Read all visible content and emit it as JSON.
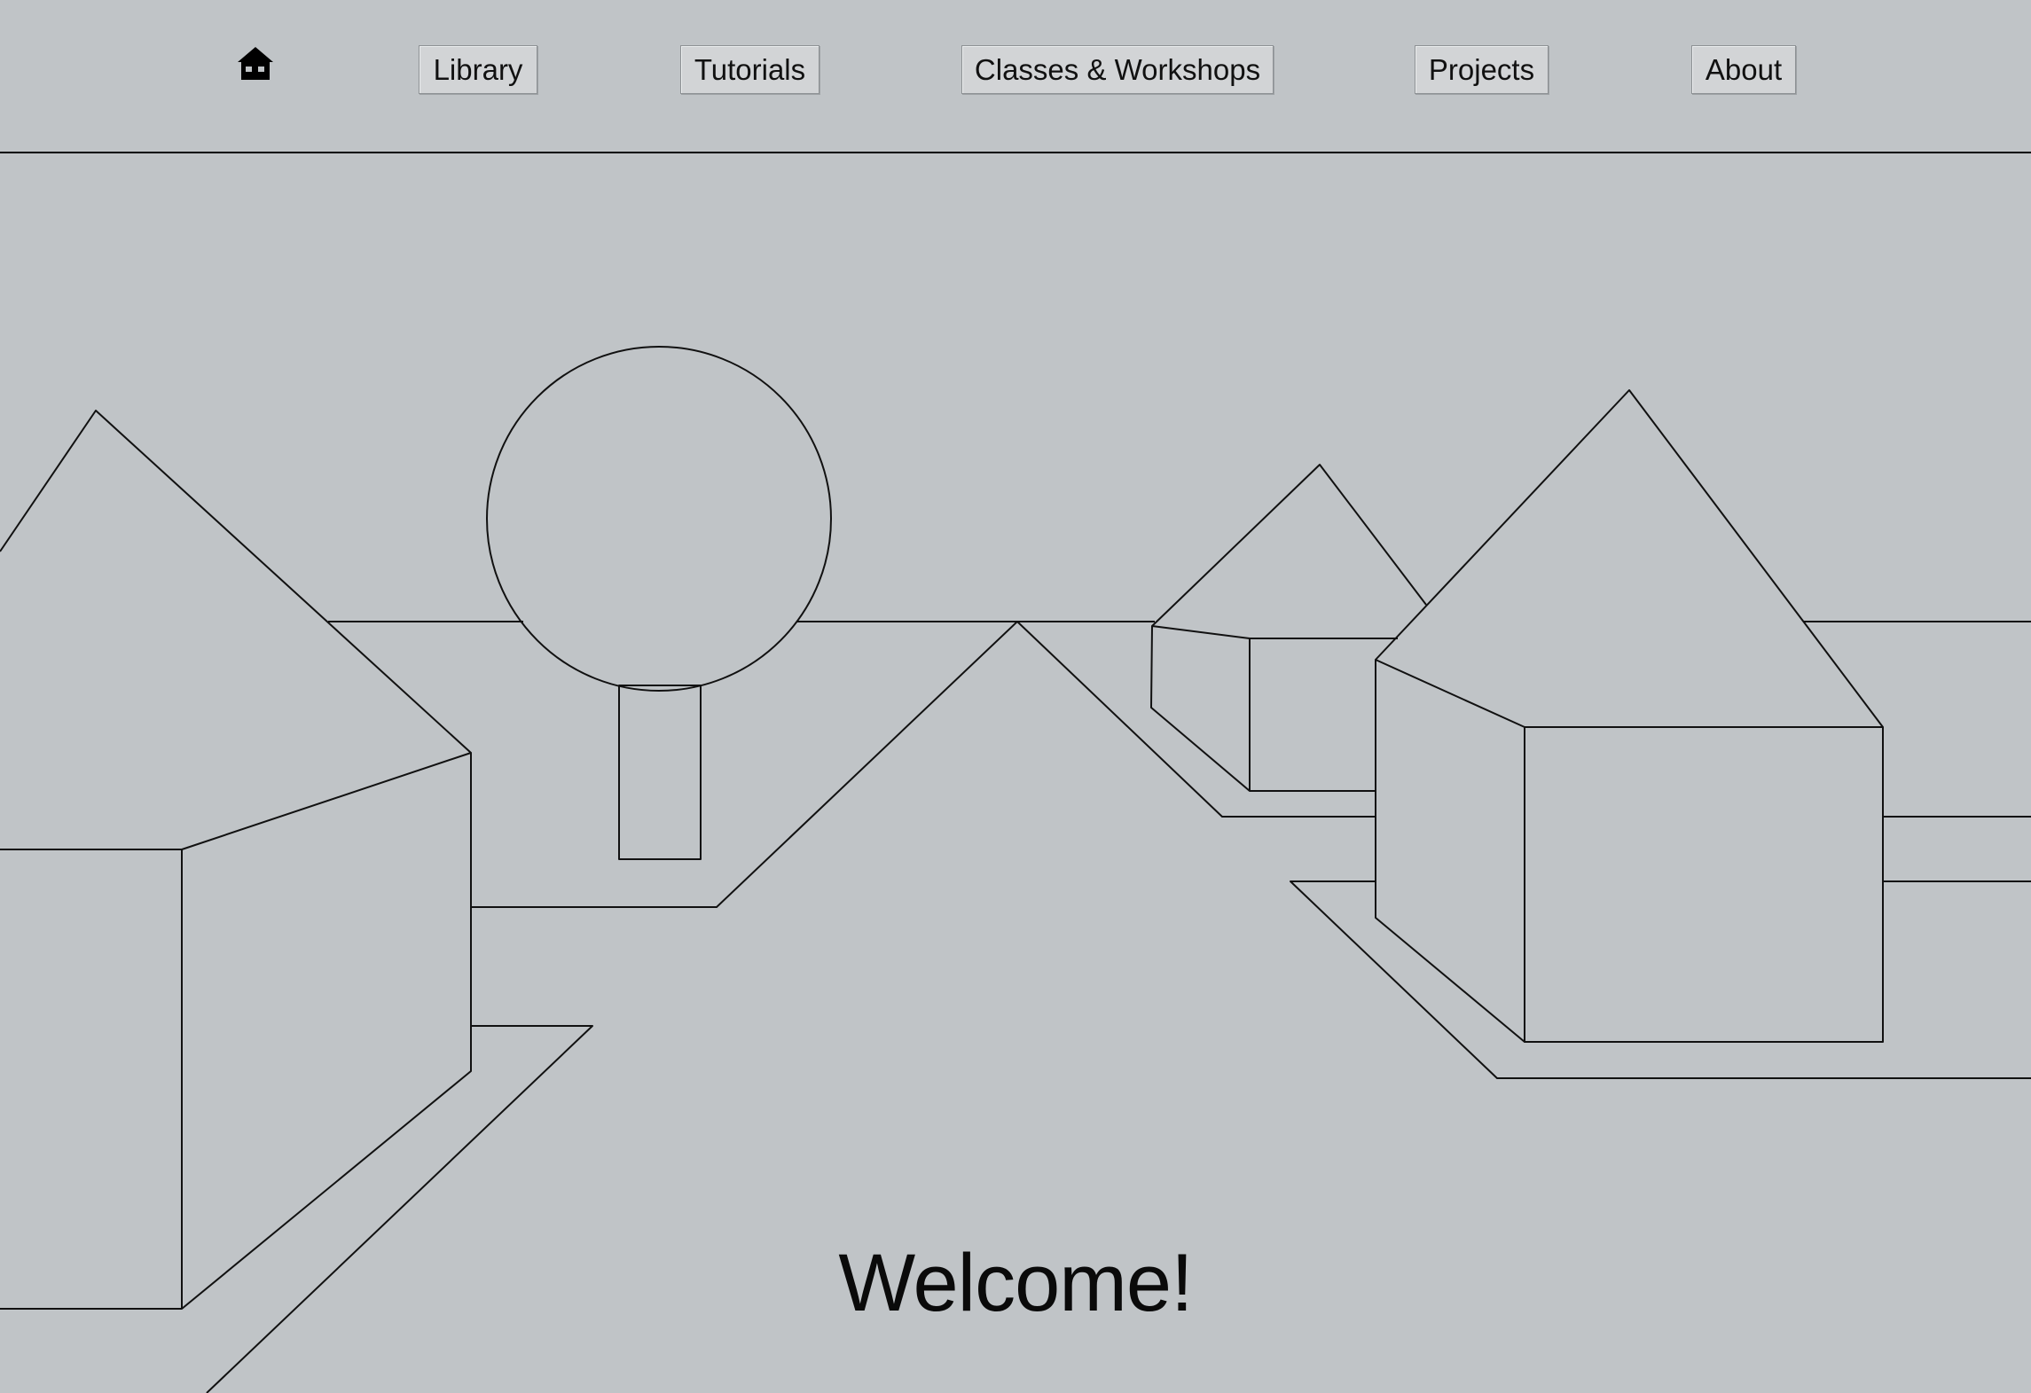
{
  "nav": {
    "home_icon": "home-icon",
    "items": [
      {
        "label": "Library"
      },
      {
        "label": "Tutorials"
      },
      {
        "label": "Classes & Workshops"
      },
      {
        "label": "Projects"
      },
      {
        "label": "About"
      }
    ]
  },
  "hero": {
    "heading": "Welcome!"
  },
  "colors": {
    "background": "#c0c4c7",
    "line": "#000000",
    "button_bg": "#d2d4d6"
  }
}
